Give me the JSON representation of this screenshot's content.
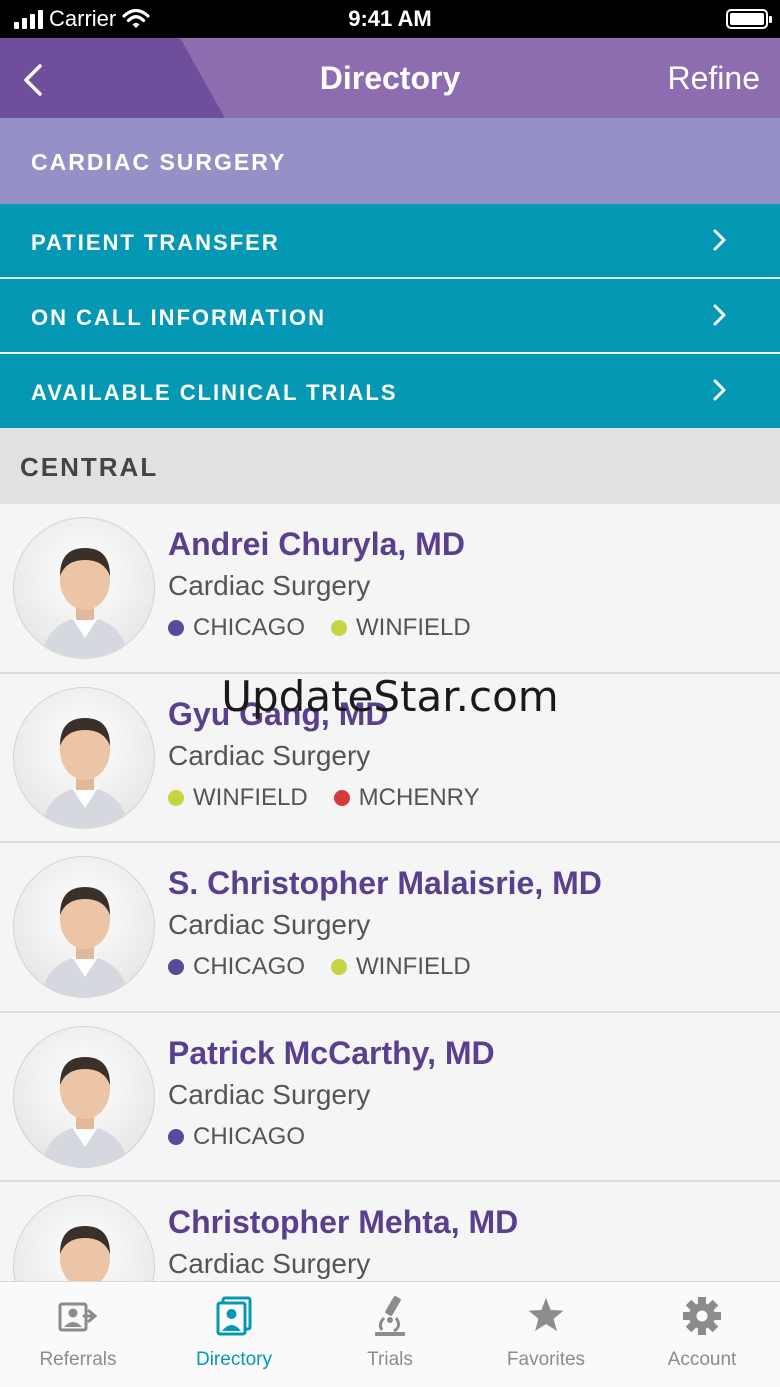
{
  "status_bar": {
    "carrier": "Carrier",
    "time": "9:41 AM"
  },
  "nav": {
    "title": "Directory",
    "refine": "Refine"
  },
  "specialty_header": "CARDIAC SURGERY",
  "links": [
    {
      "label": "PATIENT TRANSFER"
    },
    {
      "label": "ON CALL INFORMATION"
    },
    {
      "label": "AVAILABLE CLINICAL TRIALS"
    }
  ],
  "section_title": "CENTRAL",
  "location_colors": {
    "CHICAGO": "#5a4a9a",
    "WINFIELD": "#c6d444",
    "MCHENRY": "#d63a3a"
  },
  "doctors": [
    {
      "name": "Andrei Churyla, MD",
      "specialty": "Cardiac Surgery",
      "locations": [
        "CHICAGO",
        "WINFIELD"
      ]
    },
    {
      "name": "Gyu Gang, MD",
      "specialty": "Cardiac Surgery",
      "locations": [
        "WINFIELD",
        "MCHENRY"
      ]
    },
    {
      "name": "S. Christopher Malaisrie, MD",
      "specialty": "Cardiac Surgery",
      "locations": [
        "CHICAGO",
        "WINFIELD"
      ]
    },
    {
      "name": "Patrick McCarthy, MD",
      "specialty": "Cardiac Surgery",
      "locations": [
        "CHICAGO"
      ]
    },
    {
      "name": "Christopher Mehta, MD",
      "specialty": "Cardiac Surgery",
      "locations": []
    }
  ],
  "watermark": "UpdateStar.com",
  "tabs": [
    {
      "label": "Referrals",
      "icon": "referrals-icon"
    },
    {
      "label": "Directory",
      "icon": "directory-icon",
      "active": true
    },
    {
      "label": "Trials",
      "icon": "microscope-icon"
    },
    {
      "label": "Favorites",
      "icon": "star-icon"
    },
    {
      "label": "Account",
      "icon": "gear-icon"
    }
  ],
  "colors": {
    "nav": "#8d6cb0",
    "accent": "#0598b4",
    "name": "#5a3f8f",
    "specialty_bar": "#9590c6"
  }
}
